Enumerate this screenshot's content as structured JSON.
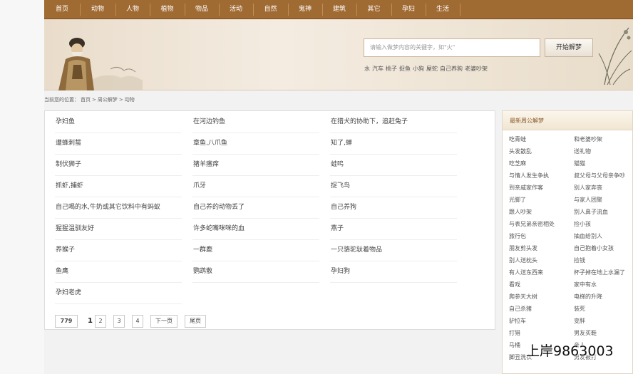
{
  "nav": {
    "items": [
      "首页",
      "动物",
      "人物",
      "植物",
      "物品",
      "活动",
      "自然",
      "鬼神",
      "建筑",
      "其它",
      "孕妇",
      "生活"
    ]
  },
  "search": {
    "placeholder": "请输入做梦内容的关键字，如\"火\"",
    "button": "开始解梦",
    "hot_links": [
      "水",
      "汽车",
      "桃子",
      "捉鱼",
      "小狗",
      "屋蛇",
      "自己养狗",
      "老婆吵架"
    ]
  },
  "breadcrumb": {
    "prefix": "当前您的位置：",
    "items": [
      "首页",
      ">",
      "周公解梦",
      ">",
      "动物"
    ]
  },
  "dream_list": [
    [
      "孕妇鱼",
      "在河边钓鱼",
      "在猎犬的协助下，追赶兔子"
    ],
    [
      "遭蜂刺蜇",
      "章鱼,八爪鱼",
      "知了,蝉"
    ],
    [
      "制伏狮子",
      "猪羊瘙痒",
      "蛙鸣"
    ],
    [
      "抓虾,捕虾",
      "爪牙",
      "捉飞鸟"
    ],
    [
      "自己喝的水,牛奶或其它饮料中有蚂蚁",
      "自己养的动物丢了",
      "自己养狗"
    ],
    [
      "猩猩温驯友好",
      "许多蛇嘴咪咪的血",
      "燕子"
    ],
    [
      "养猴子",
      "一群鹿",
      "一只骆驼驮着物品"
    ],
    [
      "鱼鹰",
      "鹦鹉散",
      "孕妇狗"
    ],
    [
      "孕妇老虎",
      "",
      ""
    ]
  ],
  "pager": {
    "total": "779",
    "current": "1",
    "pages": [
      "2",
      "3",
      "4"
    ],
    "next": "下一页",
    "last": "尾页"
  },
  "sidebar": {
    "title": "最新周公解梦",
    "items": [
      [
        "吃青蛙",
        "和老婆吵架"
      ],
      [
        "头发散乱",
        "送礼物"
      ],
      [
        "吃芝麻",
        "猫猫"
      ],
      [
        "与情人发生争执",
        "叔父母与父母亲争吵"
      ],
      [
        "到亲戚家作客",
        "别人家奔丧"
      ],
      [
        "光脚了",
        "与家人团聚"
      ],
      [
        "跟人吵架",
        "别人鼻子流血"
      ],
      [
        "与表兄弟亲密相处",
        "捡小孩"
      ],
      [
        "旅行包",
        "抽血给别人"
      ],
      [
        "朋友剪头发",
        "自己抱着小女孩"
      ],
      [
        "别人送枕头",
        "捡钱"
      ],
      [
        "有人送东西来",
        "杯子掉在地上水漏了"
      ],
      [
        "看戏",
        "家中有水"
      ],
      [
        "爬参天大树",
        "电梯的升降"
      ],
      [
        "自己杀猪",
        "装死"
      ],
      [
        "驴拉车",
        "变胖"
      ],
      [
        "打猎",
        "男友买鞋"
      ],
      [
        "马桶",
        "亲人"
      ],
      [
        "脚丑洗衣",
        "男友被打"
      ]
    ]
  },
  "watermark": "上岸9863003"
}
